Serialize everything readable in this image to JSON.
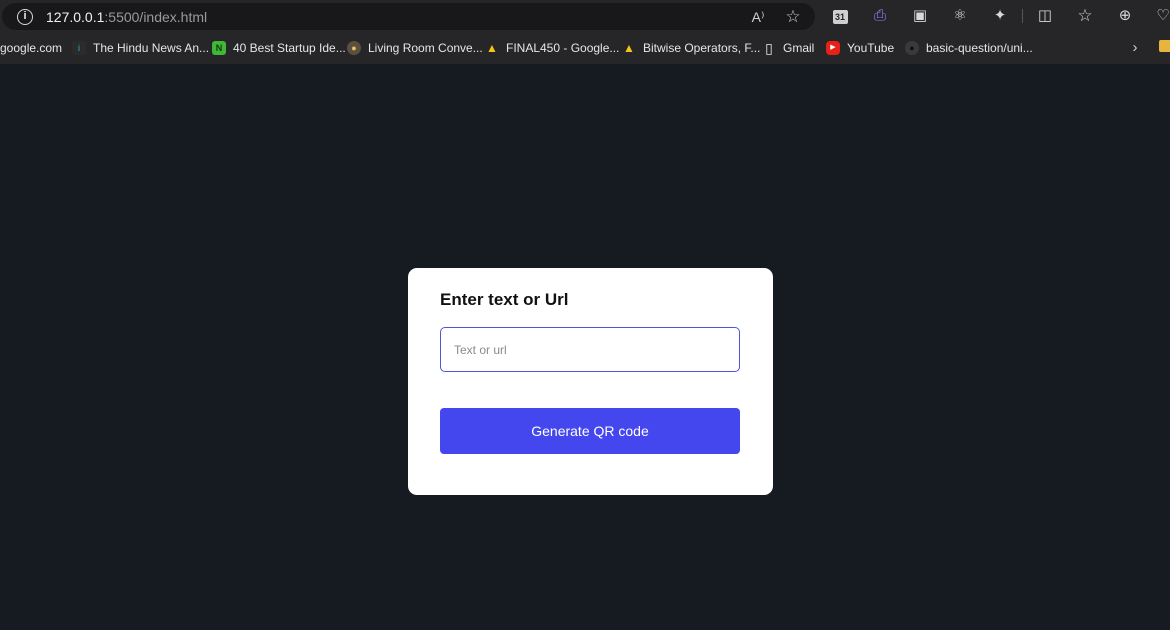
{
  "browser": {
    "url_host": "127.0.0.1",
    "url_rest": ":5500/index.html",
    "info_icon": "i",
    "read_aloud_icon": "A⁾",
    "favorite_icon": "☆",
    "extensions": [
      {
        "name": "calendar-extension-icon",
        "glyph": "31",
        "color": "#cfcfcf"
      },
      {
        "name": "paperclip-extension-icon",
        "glyph": "⎙",
        "color": "#9c7cf4"
      },
      {
        "name": "window-extension-icon",
        "glyph": "▣",
        "color": "#d8d8d8"
      },
      {
        "name": "react-extension-icon",
        "glyph": "⚛",
        "color": "#d8d8d8"
      },
      {
        "name": "puzzle-extension-icon",
        "glyph": "✦",
        "color": "#d8d8d8"
      }
    ],
    "split_screen_icon": "◫",
    "favorites_bar_icon": "☆",
    "collections_icon": "⊕",
    "health_icon": "♡",
    "chevron_icon": "›"
  },
  "bookmarks": [
    {
      "label": "google.com",
      "icon": "",
      "icon_bg": "transparent"
    },
    {
      "label": "The Hindu News An...",
      "icon": "i",
      "icon_bg": "#2b2b2b"
    },
    {
      "label": "40 Best Startup Ide...",
      "icon": "N",
      "icon_bg": "#3fb83a"
    },
    {
      "label": "Living Room Conve...",
      "icon": "●",
      "icon_bg": "#7a6a4a"
    },
    {
      "label": "FINAL450 - Google...",
      "icon": "▲",
      "icon_bg": "#2d8f4e"
    },
    {
      "label": "Bitwise Operators, F...",
      "icon": "▲",
      "icon_bg": "#2d8f4e"
    },
    {
      "label": "Gmail",
      "icon": "▯",
      "icon_bg": "transparent"
    },
    {
      "label": "YouTube",
      "icon": "▶",
      "icon_bg": "#e62117"
    },
    {
      "label": "basic-question/uni...",
      "icon": "●",
      "icon_bg": "#3a3a3a"
    }
  ],
  "card": {
    "title": "Enter text or Url",
    "input_placeholder": "Text or url",
    "input_value": "",
    "button_label": "Generate QR code"
  }
}
